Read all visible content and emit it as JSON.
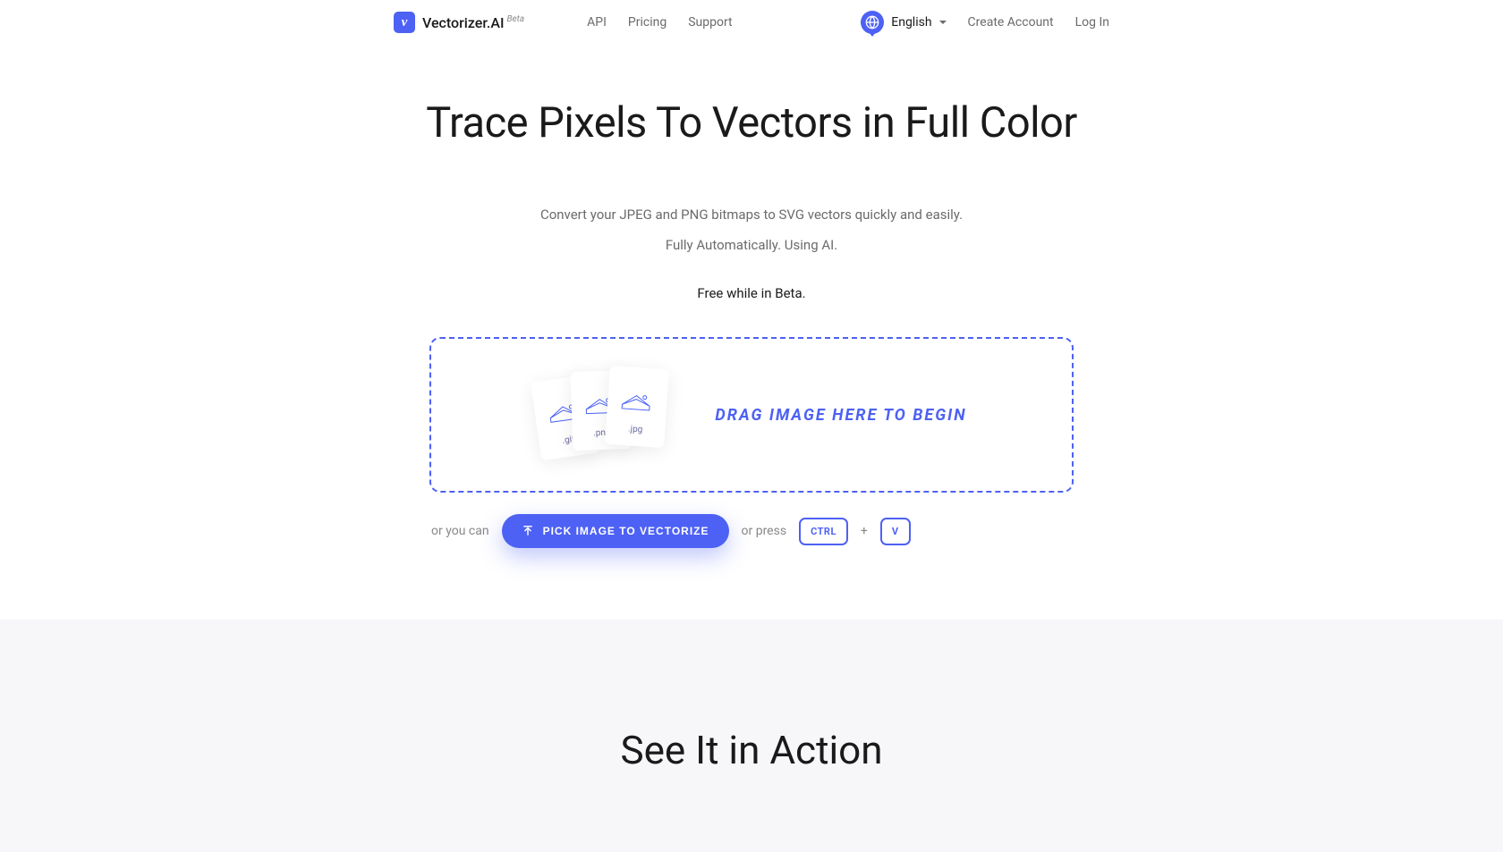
{
  "header": {
    "logo_glyph": "v",
    "brand": "Vectorizer.AI",
    "beta": "Beta",
    "nav": [
      "API",
      "Pricing",
      "Support"
    ],
    "lang": "English",
    "create_account": "Create Account",
    "log_in": "Log In"
  },
  "hero": {
    "title": "Trace Pixels To Vectors in Full Color",
    "sub1": "Convert your JPEG and PNG bitmaps to SVG vectors quickly and easily.",
    "sub2": "Fully Automatically. Using AI.",
    "free": "Free while in Beta."
  },
  "dropzone": {
    "text": "DRAG IMAGE HERE TO BEGIN",
    "files": [
      ".gif",
      ".png",
      ".jpg"
    ]
  },
  "alt": {
    "or_you_can": "or you can",
    "button": "PICK IMAGE TO VECTORIZE",
    "or_press": "or press",
    "key1": "CTRL",
    "plus": "+",
    "key2": "V"
  },
  "section2": {
    "title": "See It in Action"
  }
}
